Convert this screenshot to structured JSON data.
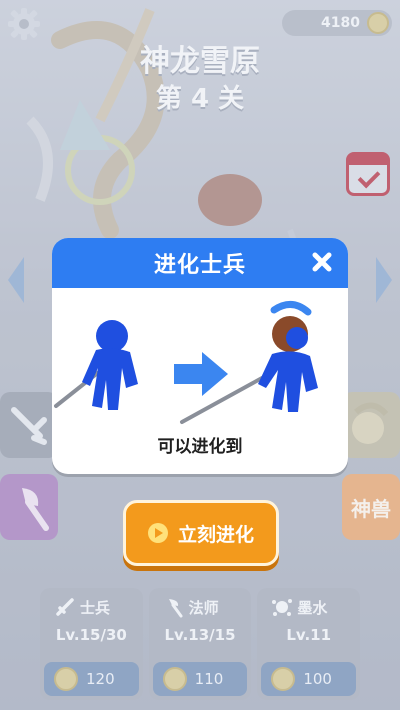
{
  "header": {
    "coins": "4180",
    "level_name": "神龙雪原",
    "level_number": "第 4 关"
  },
  "side_buttons": {
    "beast_label": "神兽"
  },
  "modal": {
    "title": "进化士兵",
    "caption": "可以进化到",
    "close_icon": "close-icon"
  },
  "evolve_button": {
    "label": "立刻进化"
  },
  "upgrade_cards": [
    {
      "name": "士兵",
      "level": "Lv.15/30",
      "cost": "120",
      "icon": "sword-icon"
    },
    {
      "name": "法师",
      "level": "Lv.13/15",
      "cost": "110",
      "icon": "axe-icon"
    },
    {
      "name": "墨水",
      "level": "Lv.11",
      "cost": "100",
      "icon": "ink-splash-icon"
    }
  ],
  "colors": {
    "modal_header": "#2e7df2",
    "evolve_button": "#f39a1c",
    "soldier_blue": "#1f4fe0",
    "helmet_brown": "#8a4a2a"
  }
}
